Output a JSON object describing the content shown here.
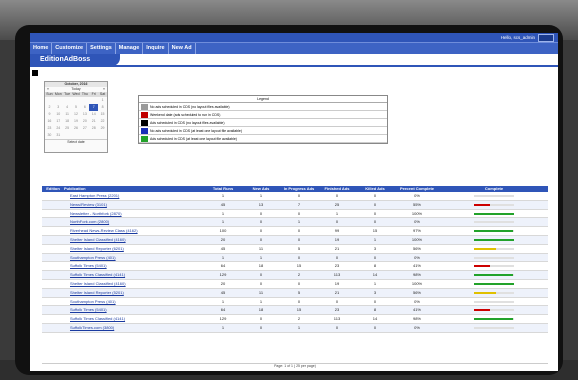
{
  "topbar": {
    "greeting": "Hello, scs_admin"
  },
  "menu": [
    {
      "label": "Home"
    },
    {
      "label": "Customize"
    },
    {
      "label": "Settings"
    },
    {
      "label": "Manage"
    },
    {
      "label": "Inquire"
    },
    {
      "label": "New Ad"
    }
  ],
  "page_title": "EditionAdBoss",
  "calendar": {
    "month_label": "October, 2016",
    "nav_prev": "«",
    "nav_label": "Today",
    "nav_next": "»",
    "days": [
      "Sun",
      "Mon",
      "Tue",
      "Wed",
      "Thu",
      "Fri",
      "Sat"
    ],
    "cells": [
      "",
      "",
      "",
      "",
      "",
      "",
      "1",
      "2",
      "3",
      "4",
      "5",
      "6",
      "7",
      "8",
      "9",
      "10",
      "11",
      "12",
      "13",
      "14",
      "15",
      "16",
      "17",
      "18",
      "19",
      "20",
      "21",
      "22",
      "23",
      "24",
      "25",
      "26",
      "27",
      "28",
      "29",
      "30",
      "31",
      "",
      "",
      "",
      "",
      ""
    ],
    "today_index": 12,
    "select_label": "Select date"
  },
  "legend": {
    "title": "Legend",
    "items": [
      {
        "color": "#9a9a9a",
        "text": "No ads scheduled in CDS (no layout files available)"
      },
      {
        "color": "#c00000",
        "text": "Weekend date (ads scheduled to run in CDS)"
      },
      {
        "color": "#000000",
        "text": "Ads scheduled in CDS (no layout files available)"
      },
      {
        "color": "#1a2fb8",
        "text": "No ads scheduled in CDS (at least one layout file available)"
      },
      {
        "color": "#22a22a",
        "text": "Ads scheduled in CDS (at least one layout file available)"
      }
    ]
  },
  "table": {
    "headers": [
      "Edition",
      "Publication",
      "Total Runs",
      "New Ads",
      "In Progress Ads",
      "Finished Ads",
      "Killed Ads",
      "Percent Complete",
      "Complete"
    ],
    "rows": [
      {
        "pub": "East Hampton Press (2201)",
        "total": "1",
        "new": "1",
        "prog": "0",
        "fin": "0",
        "kill": "0",
        "pct": "0%",
        "fill": 0,
        "color": "#e0e0e0"
      },
      {
        "pub": "News/Review (3101)",
        "total": "45",
        "new": "13",
        "prog": "7",
        "fin": "25",
        "kill": "0",
        "pct": "55%",
        "fill": 0.4,
        "color": "#cc0000"
      },
      {
        "pub": "Newsletter - Northfork (2870)",
        "total": "1",
        "new": "0",
        "prog": "0",
        "fin": "1",
        "kill": "0",
        "pct": "100%",
        "fill": 1,
        "color": "#22a22a"
      },
      {
        "pub": "NorthFork.com (2800)",
        "total": "1",
        "new": "0",
        "prog": "1",
        "fin": "0",
        "kill": "0",
        "pct": "0%",
        "fill": 0,
        "color": "#e0e0e0"
      },
      {
        "pub": "Riverhead News-Review Class (4162)",
        "total": "100",
        "new": "0",
        "prog": "0",
        "fin": "99",
        "kill": "15",
        "pct": "97%",
        "fill": 0.97,
        "color": "#22a22a"
      },
      {
        "pub": "Shelter Island Classified (4160)",
        "total": "20",
        "new": "0",
        "prog": "0",
        "fin": "19",
        "kill": "1",
        "pct": "100%",
        "fill": 1,
        "color": "#22a22a"
      },
      {
        "pub": "Shelter Island Reporter (6201)",
        "total": "45",
        "new": "11",
        "prog": "5",
        "fin": "21",
        "kill": "3",
        "pct": "56%",
        "fill": 0.56,
        "color": "#e0c000"
      },
      {
        "pub": "Southampton Press (401)",
        "total": "1",
        "new": "1",
        "prog": "0",
        "fin": "0",
        "kill": "0",
        "pct": "0%",
        "fill": 0,
        "color": "#e0e0e0"
      },
      {
        "pub": "Suffolk Times (5401)",
        "total": "64",
        "new": "18",
        "prog": "15",
        "fin": "23",
        "kill": "8",
        "pct": "41%",
        "fill": 0.41,
        "color": "#cc0000"
      },
      {
        "pub": "Suffolk Times Classified (4141)",
        "total": "129",
        "new": "0",
        "prog": "2",
        "fin": "113",
        "kill": "14",
        "pct": "98%",
        "fill": 0.98,
        "color": "#22a22a"
      },
      {
        "pub": "Shelter Island Classified (4160)",
        "total": "20",
        "new": "0",
        "prog": "0",
        "fin": "19",
        "kill": "1",
        "pct": "100%",
        "fill": 1,
        "color": "#22a22a"
      },
      {
        "pub": "Shelter Island Reporter (5201)",
        "total": "45",
        "new": "11",
        "prog": "5",
        "fin": "21",
        "kill": "3",
        "pct": "56%",
        "fill": 0.56,
        "color": "#e0c000"
      },
      {
        "pub": "Southampton Press (401)",
        "total": "1",
        "new": "1",
        "prog": "0",
        "fin": "0",
        "kill": "0",
        "pct": "0%",
        "fill": 0,
        "color": "#e0e0e0"
      },
      {
        "pub": "Suffolk Times (5401)",
        "total": "64",
        "new": "18",
        "prog": "15",
        "fin": "23",
        "kill": "8",
        "pct": "41%",
        "fill": 0.41,
        "color": "#cc0000"
      },
      {
        "pub": "Suffolk Times Classified (4141)",
        "total": "129",
        "new": "0",
        "prog": "2",
        "fin": "113",
        "kill": "14",
        "pct": "98%",
        "fill": 0.98,
        "color": "#22a22a"
      },
      {
        "pub": "SuffolkTimes.com (3800)",
        "total": "1",
        "new": "0",
        "prog": "1",
        "fin": "0",
        "kill": "0",
        "pct": "0%",
        "fill": 0,
        "color": "#e0e0e0"
      }
    ]
  },
  "footer": {
    "pager": "Page: 1 of 1 ( 25 per page)"
  }
}
